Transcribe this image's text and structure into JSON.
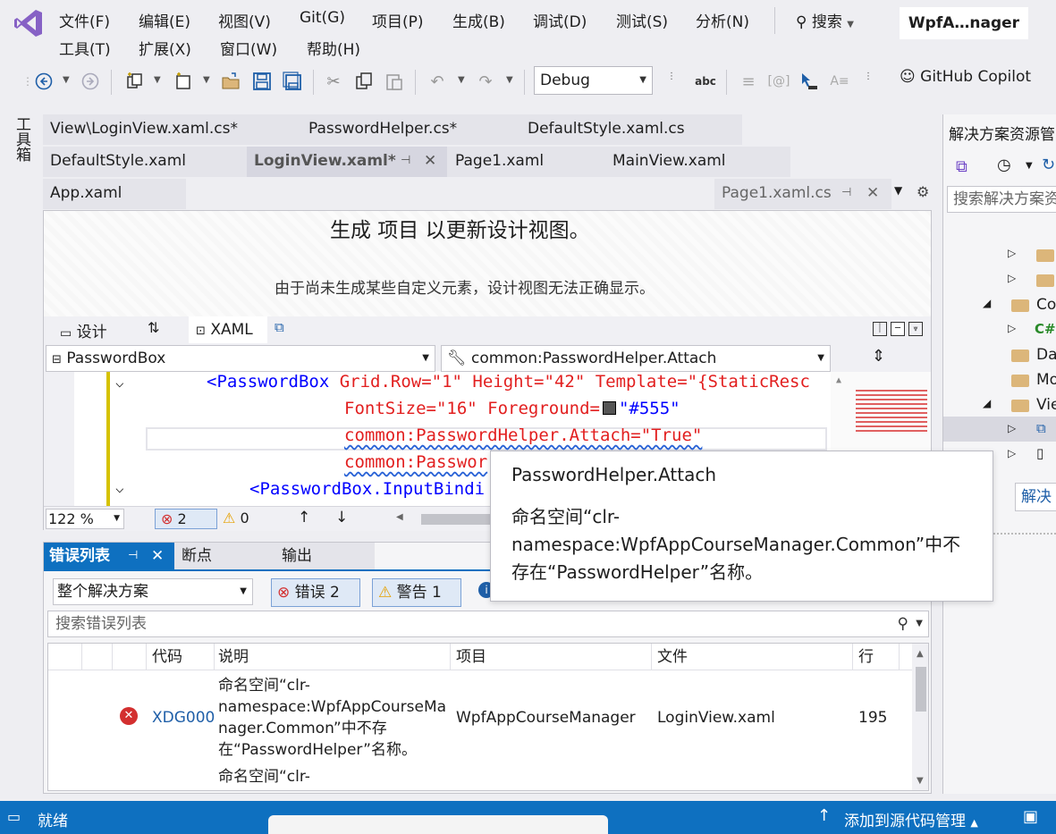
{
  "menu": {
    "row1": [
      "文件(F)",
      "编辑(E)",
      "视图(V)",
      "Git(G)",
      "项目(P)",
      "生成(B)",
      "调试(D)",
      "测试(S)",
      "分析(N)"
    ],
    "row2": [
      "工具(T)",
      "扩展(X)",
      "窗口(W)",
      "帮助(H)"
    ],
    "search_label": "搜索",
    "solution_name": "WpfA…nager"
  },
  "toolbar": {
    "config": "Debug",
    "copilot": "GitHub Copilot"
  },
  "toolbox_label": "工具箱",
  "doc_tabs": {
    "row1": [
      "View\\LoginView.xaml.cs*",
      "PasswordHelper.cs*",
      "DefaultStyle.xaml.cs"
    ],
    "row2": [
      "DefaultStyle.xaml",
      "LoginView.xaml*",
      "Page1.xaml",
      "MainView.xaml"
    ],
    "row3": [
      "App.xaml",
      "Page1.xaml.cs"
    ]
  },
  "designer": {
    "message": "生成 项目 以更新设计视图。",
    "sub_message": "由于尚未生成某些自定义元素，设计视图无法正确显示。",
    "design_tab": "设计",
    "xaml_tab": "XAML",
    "element_combo": "PasswordBox",
    "member_combo": "common:PasswordHelper.Attach"
  },
  "code": {
    "line1_tag": "<PasswordBox",
    "line1_attrs": " Grid.Row=\"1\" Height=\"42\" Template=\"{StaticResc",
    "line2": "FontSize=\"16\" Foreground=",
    "line2_val": "\"#555\"",
    "line3": "common:PasswordHelper.Attach=\"True\"",
    "line4": "common:Passwor",
    "line5": "<PasswordBox.InputBindi"
  },
  "editor_status": {
    "zoom": "122 %",
    "errors": "2",
    "warnings": "0"
  },
  "tooltip": {
    "title": "PasswordHelper.Attach",
    "body": "命名空间“clr-\nnamespace:WpfAppCourseManager.Common”中不\n存在“PasswordHelper”名称。"
  },
  "error_panel": {
    "tabs": [
      "错误列表",
      "断点",
      "输出"
    ],
    "scope": "整个解决方案",
    "errors_btn": "错误 2",
    "warnings_btn": "警告 1",
    "search_placeholder": "搜索错误列表",
    "headers": [
      "代码",
      "说明",
      "项目",
      "文件",
      "行"
    ],
    "rows": [
      {
        "code": "XDG000",
        "description": "命名空间“clr-\nnamespace:WpfAppCourseMa\nnager.Common”中不存\n在“PasswordHelper”名称。",
        "project": "WpfAppCourseManager",
        "file": "LoginView.xaml",
        "line": "195"
      },
      {
        "code": "",
        "description": "命名空间“clr-",
        "project": "",
        "file": "",
        "line": ""
      }
    ]
  },
  "solution_explorer": {
    "title": "解决方案资源管",
    "search": "搜索解决方案资",
    "items": [
      "Co",
      "C#",
      "Da",
      "Mo",
      "Vie"
    ],
    "bottom_tab": "解决"
  },
  "statusbar": {
    "ready": "就绪",
    "source_control": "添加到源代码管理"
  },
  "colors": {
    "accent": "#0e70c0",
    "error": "#d32f2f",
    "warning": "#e5a000",
    "vs_purple": "#6a3fc4"
  }
}
